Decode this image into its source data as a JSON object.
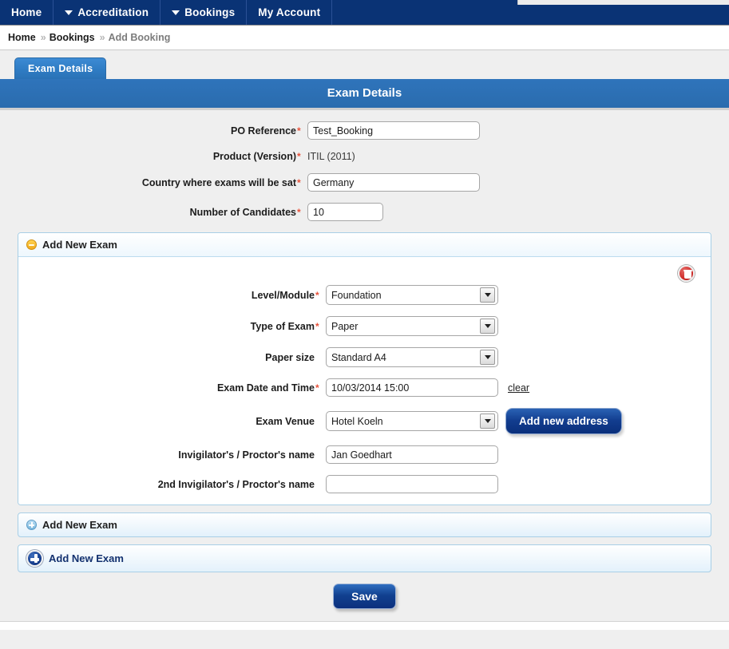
{
  "nav": {
    "items": [
      {
        "label": "Home",
        "has_dropdown": false
      },
      {
        "label": "Accreditation",
        "has_dropdown": true
      },
      {
        "label": "Bookings",
        "has_dropdown": true
      },
      {
        "label": "My Account",
        "has_dropdown": false
      }
    ]
  },
  "breadcrumb": {
    "items": [
      "Home",
      "Bookings",
      "Add Booking"
    ],
    "separator": "»"
  },
  "tabs": [
    {
      "label": "Exam Details",
      "active": true
    }
  ],
  "panel": {
    "title": "Exam Details"
  },
  "booking_form": {
    "fields": [
      {
        "label": "PO Reference",
        "required": true,
        "type": "text",
        "value": "Test_Booking",
        "placeholder": ""
      },
      {
        "label": "Product (Version)",
        "required": true,
        "type": "static",
        "value": "ITIL (2011)"
      },
      {
        "label": "Country where exams will be sat",
        "required": true,
        "type": "text",
        "value": "Germany",
        "placeholder": ""
      },
      {
        "label": "Number of Candidates",
        "required": true,
        "type": "text",
        "value": "10",
        "placeholder": ""
      }
    ]
  },
  "exam_section": {
    "header_title": "Add New Exam",
    "collapse_icon": "minus-circle-icon",
    "delete_icon": "trash-icon",
    "fields": [
      {
        "label": "Level/Module",
        "required": true,
        "type": "select",
        "value": "Foundation"
      },
      {
        "label": "Type of Exam",
        "required": true,
        "type": "select",
        "value": "Paper"
      },
      {
        "label": "Paper size",
        "required": false,
        "type": "select",
        "value": "Standard A4"
      },
      {
        "label": "Exam Date and Time",
        "required": true,
        "type": "text",
        "value": "10/03/2014 15:00",
        "placeholder": "",
        "trailing_link": "clear"
      },
      {
        "label": "Exam Venue",
        "required": false,
        "type": "select",
        "value": "Hotel Koeln",
        "trailing_button": "Add new address"
      },
      {
        "label": "Invigilator's / Proctor's name",
        "required": false,
        "type": "text",
        "value": "Jan Goedhart",
        "placeholder": ""
      },
      {
        "label": "2nd Invigilator's / Proctor's name",
        "required": false,
        "type": "text",
        "value": "",
        "placeholder": ""
      }
    ]
  },
  "add_rows": [
    {
      "label": "Add New Exam",
      "icon": "plus-circle-small-icon",
      "style": "collapsed"
    },
    {
      "label": "Add New Exam",
      "icon": "plus-circle-large-icon",
      "style": "primary"
    }
  ],
  "actions": {
    "save_label": "Save"
  },
  "colors": {
    "nav_blue": "#0a3375",
    "panel_blue": "#2f74bb",
    "tab_blue": "#3d8bd4",
    "required_red": "#e8533c",
    "accordion_border": "#a8cfe6",
    "page_gray": "#efefef",
    "button_blue": "#123d8f",
    "delete_red": "#cf2a27",
    "collapse_orange": "#f0a91c"
  }
}
